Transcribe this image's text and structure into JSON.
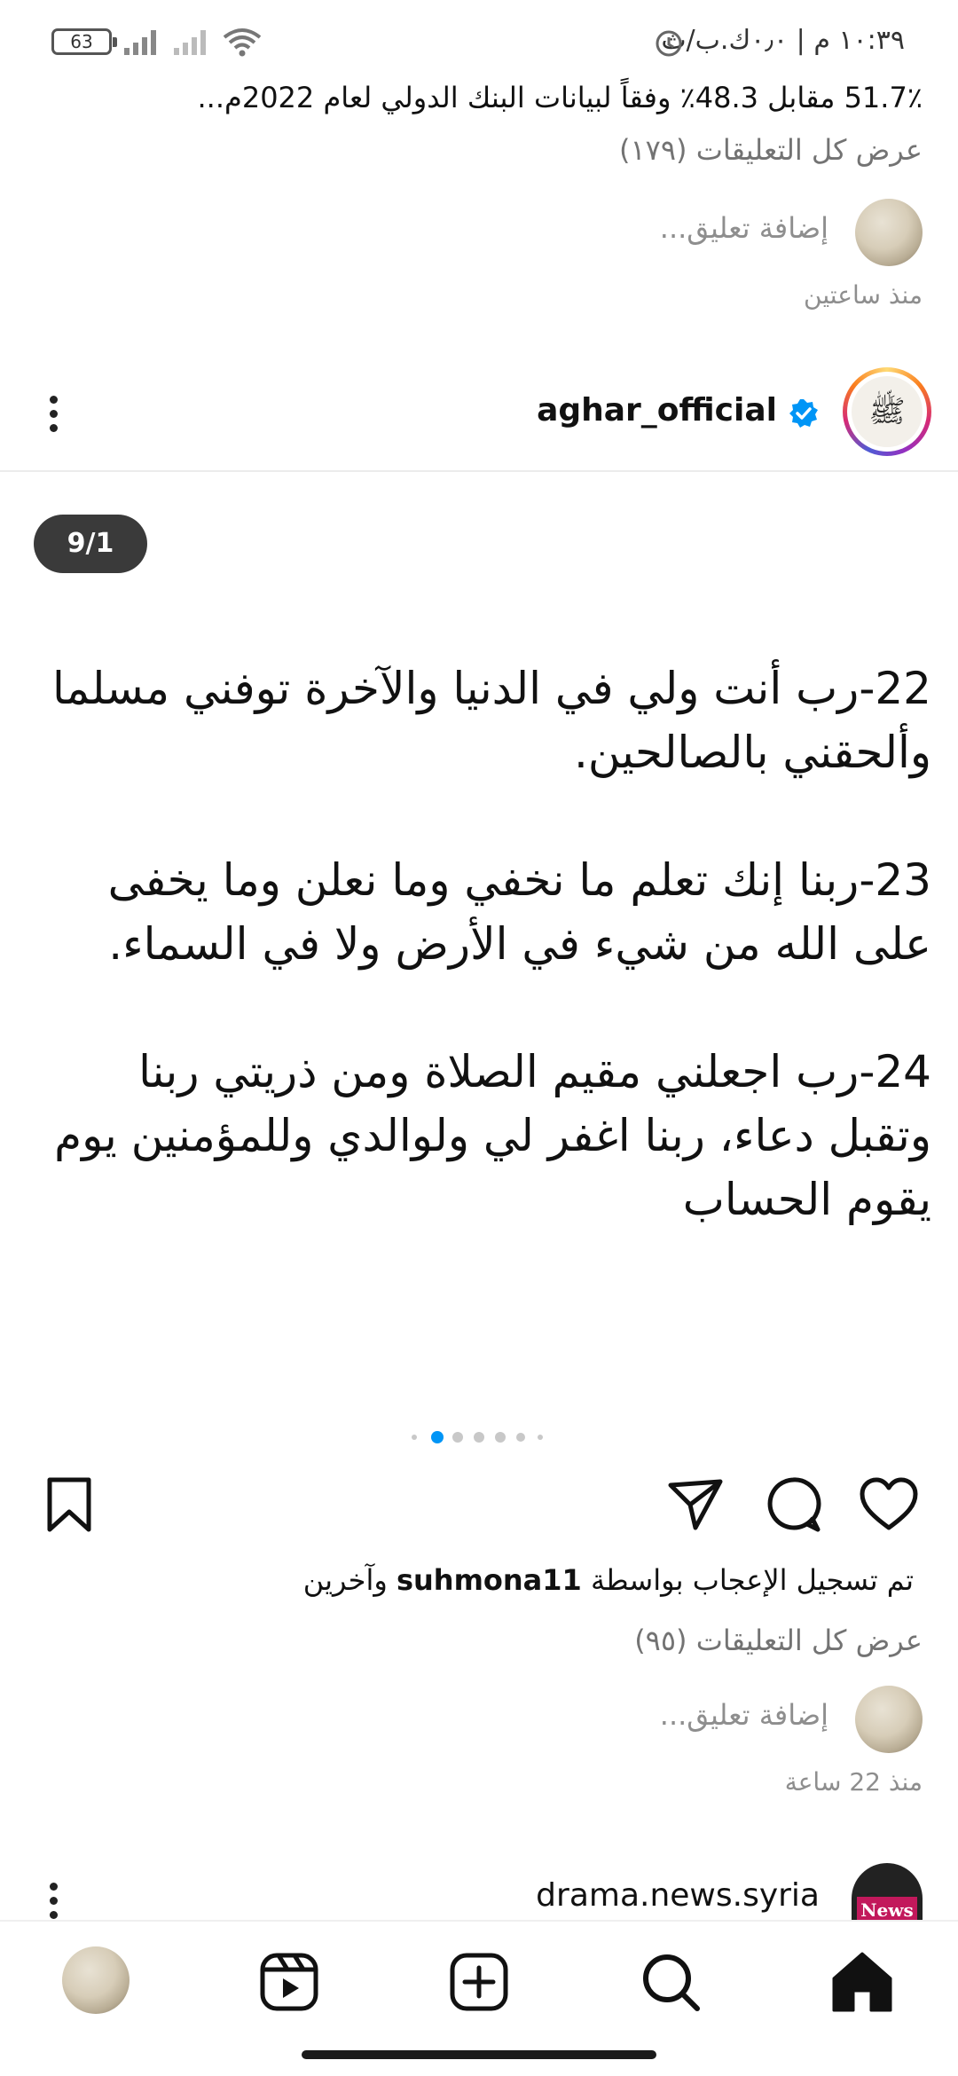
{
  "status_bar": {
    "time": "١٠:٣٩ م | ٠٫٠ك.ب/ث",
    "battery": "63"
  },
  "previous_post": {
    "caption_tail": "51.7٪ مقابل 48.3٪ وفقاً لبيانات البنك الدولي لعام 2022م...",
    "view_comments": "عرض كل التعليقات (١٧٩)",
    "add_comment_placeholder": "إضافة تعليق...",
    "time_ago": "منذ ساعتين"
  },
  "post": {
    "username": "aghar_official",
    "slide_counter": "9/1",
    "slide_paragraphs": [
      "22-رب أنت ولي في الدنيا والآخرة توفني مسلما وألحقني بالصالحين.",
      "23-ربنا إنك تعلم ما نخفي وما نعلن وما يخفى على الله من شيء في الأرض ولا في السماء.",
      "24-رب اجعلني مقيم الصلاة ومن ذريتي ربنا وتقبل دعاء، ربنا اغفر لي ولوالدي وللمؤمنين يوم يقوم الحساب"
    ],
    "carousel": {
      "count": 7,
      "active_index": 0
    },
    "likes_prefix": "تم تسجيل الإعجاب بواسطة",
    "likes_user": "suhmona11",
    "likes_suffix": "وآخرين",
    "view_comments": "عرض كل التعليقات (٩٥)",
    "add_comment_placeholder": "إضافة تعليق...",
    "time_ago": "منذ 22 ساعة"
  },
  "next_post": {
    "username": "drama.news.syria",
    "avatar_text": "News"
  },
  "icons": {
    "bookmark": "bookmark-icon",
    "share": "send-icon",
    "comment": "comment-icon",
    "like": "heart-icon",
    "more": "more-options-icon",
    "verified": "verified-badge-icon"
  },
  "colors": {
    "verified": "#0095f6",
    "active_dot": "#0095f6",
    "secondary_text": "#737373"
  }
}
